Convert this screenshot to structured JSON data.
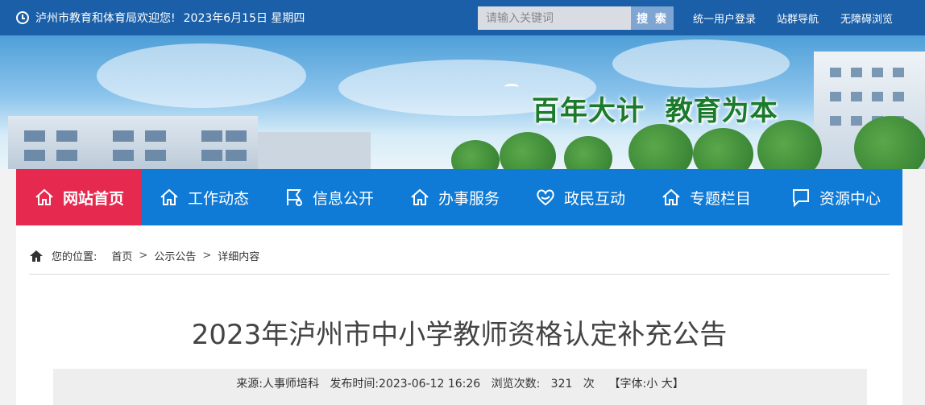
{
  "topbar": {
    "welcome": "泸州市教育和体育局欢迎您!",
    "date": "2023年6月15日 星期四",
    "search_placeholder": "请输入关键词",
    "search_button": "搜 索",
    "links": [
      "统一用户登录",
      "站群导航",
      "无障碍浏览"
    ],
    "bg_color": "#1a5fa8"
  },
  "banner": {
    "slogan_1": "百年大计",
    "slogan_2": "教育为本"
  },
  "nav": {
    "items": [
      {
        "label": "网站首页",
        "icon": "home-icon",
        "active": true
      },
      {
        "label": "工作动态",
        "icon": "home-outline-icon",
        "active": false
      },
      {
        "label": "信息公开",
        "icon": "flag-icon",
        "active": false
      },
      {
        "label": "办事服务",
        "icon": "home-outline-icon",
        "active": false
      },
      {
        "label": "政民互动",
        "icon": "heart-icon",
        "active": false
      },
      {
        "label": "专题栏目",
        "icon": "home-outline-icon",
        "active": false
      },
      {
        "label": "资源中心",
        "icon": "chat-icon",
        "active": false
      }
    ],
    "active_color": "#e6294e",
    "bg_color": "#0f7bd6"
  },
  "breadcrumb": {
    "label": "您的位置:",
    "items": [
      "首页",
      "公示公告",
      "详细内容"
    ],
    "separator": ">"
  },
  "article": {
    "title": "2023年泸州市中小学教师资格认定补充公告",
    "source_label": "来源:",
    "source": "人事师培科",
    "publish_label": "发布时间:",
    "publish_time": "2023-06-12 16:26",
    "views_label": "浏览次数:",
    "views": "321",
    "views_unit": "次",
    "font_label": "【字体:",
    "font_small": "小",
    "font_large": "大",
    "font_close": "】"
  }
}
